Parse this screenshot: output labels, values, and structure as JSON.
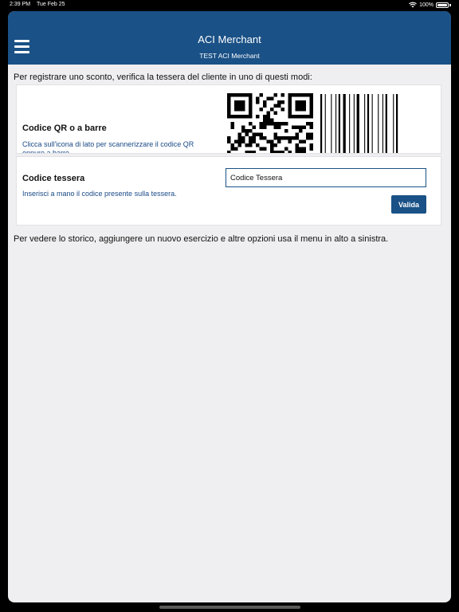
{
  "status": {
    "time": "2:39 PM",
    "date": "Tue Feb 25",
    "battery": "100%"
  },
  "header": {
    "title": "ACI Merchant",
    "subtitle": "TEST ACI Merchant"
  },
  "intro": "Per registrare uno sconto, verifica la tessera del cliente in uno di questi modi:",
  "scan_card": {
    "title": "Codice QR o a barre",
    "description": "Clicca sull'icona di lato per scannerizzare il codice QR oppure a barre"
  },
  "code_card": {
    "title": "Codice tessera",
    "description": "Inserisci a mano il codice presente sulla tessera.",
    "input_value": "Codice Tessera",
    "button_label": "Valida"
  },
  "footer": "Per vedere lo storico, aggiungere un nuovo esercizio e altre opzioni usa il menu in alto a sinistra.",
  "colors": {
    "header": "#1a5186",
    "background": "#efeff1",
    "link_text": "#1a4a86"
  }
}
